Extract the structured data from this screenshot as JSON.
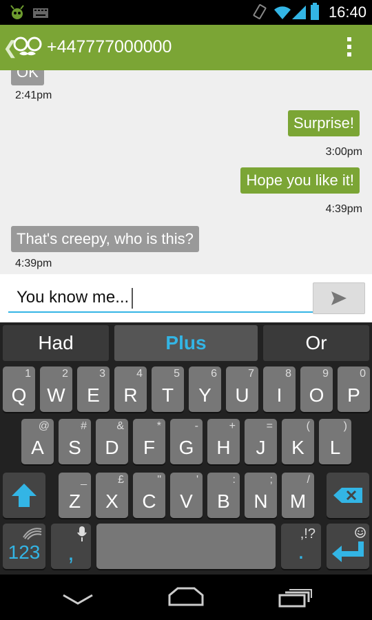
{
  "status_bar": {
    "time": "16:40",
    "icons": [
      "debug-bug-icon",
      "keyboard-icon",
      "rotate-icon",
      "wifi-icon",
      "signal-icon",
      "battery-icon"
    ]
  },
  "app_bar": {
    "title": "+447777000000",
    "back_icon": "back-chevron-icon",
    "logo_icon": "spy-glasses-icon",
    "menu_icon": "overflow-menu-icon",
    "color": "#7ba535"
  },
  "conversation": {
    "messages": [
      {
        "text": "OK",
        "direction": "incoming",
        "time": "2:41pm"
      },
      {
        "text": "Surprise!",
        "direction": "outgoing",
        "time": "3:00pm"
      },
      {
        "text": "Hope you like it!",
        "direction": "outgoing",
        "time": "4:39pm"
      },
      {
        "text": "That's creepy, who is this?",
        "direction": "incoming",
        "time": "4:39pm"
      }
    ]
  },
  "compose": {
    "value": "You know me...",
    "send_icon": "send-icon"
  },
  "keyboard": {
    "suggestions": [
      "Had",
      "Plus",
      "Or"
    ],
    "row1": [
      {
        "main": "Q",
        "sub": "1"
      },
      {
        "main": "W",
        "sub": "2"
      },
      {
        "main": "E",
        "sub": "3"
      },
      {
        "main": "R",
        "sub": "4"
      },
      {
        "main": "T",
        "sub": "5"
      },
      {
        "main": "Y",
        "sub": "6"
      },
      {
        "main": "U",
        "sub": "7"
      },
      {
        "main": "I",
        "sub": "8"
      },
      {
        "main": "O",
        "sub": "9"
      },
      {
        "main": "P",
        "sub": "0"
      }
    ],
    "row2": [
      {
        "main": "A",
        "sub": "@"
      },
      {
        "main": "S",
        "sub": "#"
      },
      {
        "main": "D",
        "sub": "&"
      },
      {
        "main": "F",
        "sub": "*"
      },
      {
        "main": "G",
        "sub": "-"
      },
      {
        "main": "H",
        "sub": "+"
      },
      {
        "main": "J",
        "sub": "="
      },
      {
        "main": "K",
        "sub": "("
      },
      {
        "main": "L",
        "sub": ")"
      }
    ],
    "row3": [
      {
        "main": "Z",
        "sub": "_"
      },
      {
        "main": "X",
        "sub": "£"
      },
      {
        "main": "C",
        "sub": "\""
      },
      {
        "main": "V",
        "sub": "'"
      },
      {
        "main": "B",
        "sub": ":"
      },
      {
        "main": "N",
        "sub": ";"
      },
      {
        "main": "M",
        "sub": "/"
      }
    ],
    "numbers_key": "123",
    "comma_key": ",",
    "period_key": ".",
    "punct_hint": ",!?",
    "accent_color": "#33b5e5"
  },
  "nav_bar": {
    "icons": [
      "nav-back-icon",
      "nav-home-icon",
      "nav-recents-icon"
    ]
  }
}
